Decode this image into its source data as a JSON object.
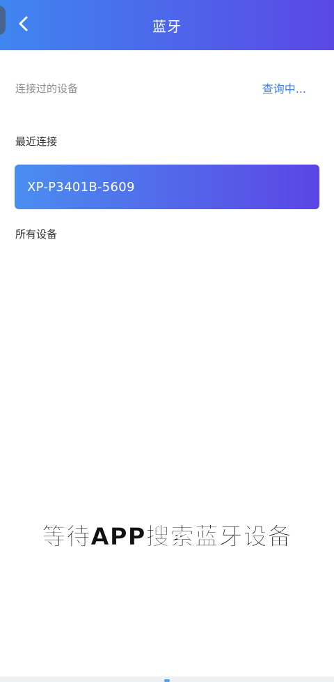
{
  "header": {
    "title": "蓝牙",
    "back_icon": "chevron-left-icon",
    "gradient_start": "#3f86f0",
    "gradient_end": "#5a48e6"
  },
  "connected_section": {
    "label": "连接过的设备",
    "status": "查询中..."
  },
  "recent_section": {
    "label": "最近连接",
    "devices": [
      {
        "name": "XP-P3401B-5609"
      }
    ]
  },
  "all_devices_section": {
    "label": "所有设备"
  },
  "caption": {
    "text": "等待APP搜索蓝牙设备"
  },
  "colors": {
    "accent_link": "#3f7fe8",
    "muted_text": "#8a8d94"
  }
}
